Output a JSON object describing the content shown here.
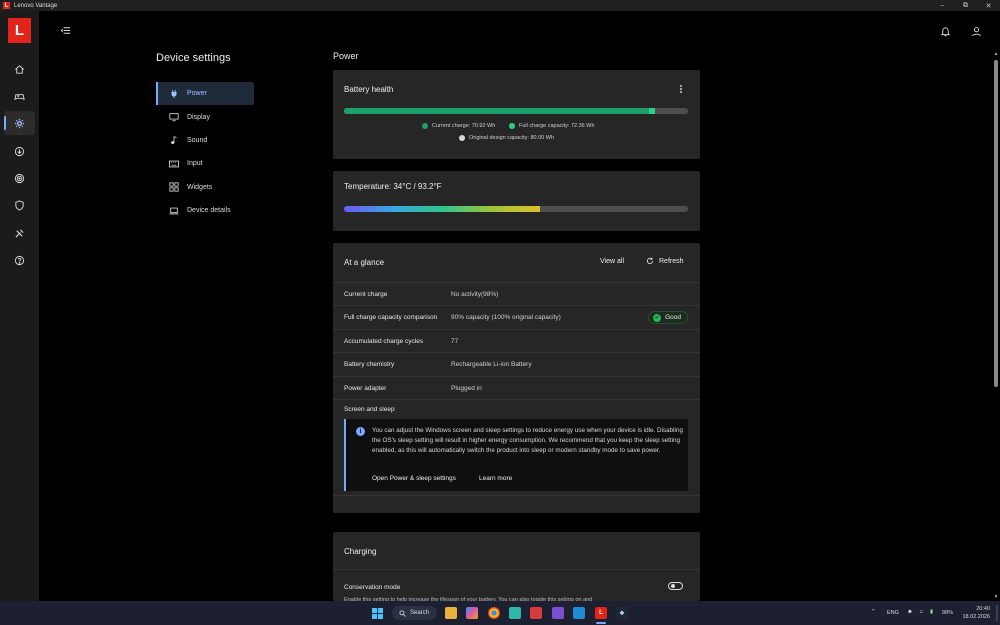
{
  "window": {
    "title": "Lenovo Vantage",
    "controls": [
      "minimize",
      "maximize",
      "close"
    ]
  },
  "logo_letter": "L",
  "rail": {
    "items": [
      {
        "icon": "home-icon"
      },
      {
        "icon": "gamepad-icon"
      },
      {
        "icon": "gear-icon",
        "active": true
      },
      {
        "icon": "download-icon"
      },
      {
        "icon": "radar-icon"
      },
      {
        "icon": "shield-icon"
      },
      {
        "icon": "tools-icon"
      },
      {
        "icon": "help-icon"
      }
    ]
  },
  "settings": {
    "title": "Device settings",
    "nav": [
      {
        "label": "Power",
        "icon": "plug-icon",
        "active": true
      },
      {
        "label": "Display",
        "icon": "monitor-icon"
      },
      {
        "label": "Sound",
        "icon": "music-note-icon"
      },
      {
        "label": "Input",
        "icon": "keyboard-icon"
      },
      {
        "label": "Widgets",
        "icon": "widgets-icon"
      },
      {
        "label": "Device details",
        "icon": "laptop-icon"
      }
    ]
  },
  "power": {
    "title": "Power",
    "battery_health": {
      "title": "Battery health",
      "bar": {
        "current_fraction": 0.886,
        "full_fraction": 0.904
      },
      "legend": {
        "current": "Current charge: 70.92 Wh",
        "full": "Full charge capacity: 72.36 Wh",
        "original": "Original design capacity: 80.00 Wh"
      },
      "colors": {
        "current": "#1e9e6a",
        "full": "#2dcf86",
        "original": "#d9d9d9"
      }
    },
    "temperature": {
      "title": "Temperature:  34°C / 93.2°F",
      "fraction": 0.57
    },
    "at_a_glance": {
      "title": "At a glance",
      "view_all": "View all",
      "refresh": "Refresh",
      "rows": [
        {
          "key": "Current charge",
          "value": "No activity(98%)"
        },
        {
          "key": "Full charge capacity comparison",
          "value": "90% capacity (100% original capacity)",
          "badge": "Good"
        },
        {
          "key": "Accumulated charge cycles",
          "value": "77"
        },
        {
          "key": "Battery chemistry",
          "value": "Rechargeable Li-ion Battery"
        },
        {
          "key": "Power adapter",
          "value": "Plugged in"
        }
      ],
      "screen_sleep": {
        "title": "Screen and sleep",
        "text": "You can adjust the Windows screen and sleep settings to reduce energy use when your device is idle. Disabling the OS's sleep setting will result in higher energy consumption. We recommend that you keep the sleep setting enabled, as this will automatically switch the product into sleep or modern standby mode to save power.",
        "link_settings": "Open Power & sleep settings",
        "link_learn": "Learn more"
      }
    },
    "charging": {
      "title": "Charging",
      "conservation_mode": "Conservation mode",
      "conservation_on": false,
      "conservation_desc": "Enable this setting to help increase the lifespan of your battery. You can also toggle this setting on and"
    }
  },
  "taskbar": {
    "search": "Search",
    "lang": "ENG",
    "battery": "98%",
    "time": "20:40",
    "date": "18.02.2026"
  }
}
